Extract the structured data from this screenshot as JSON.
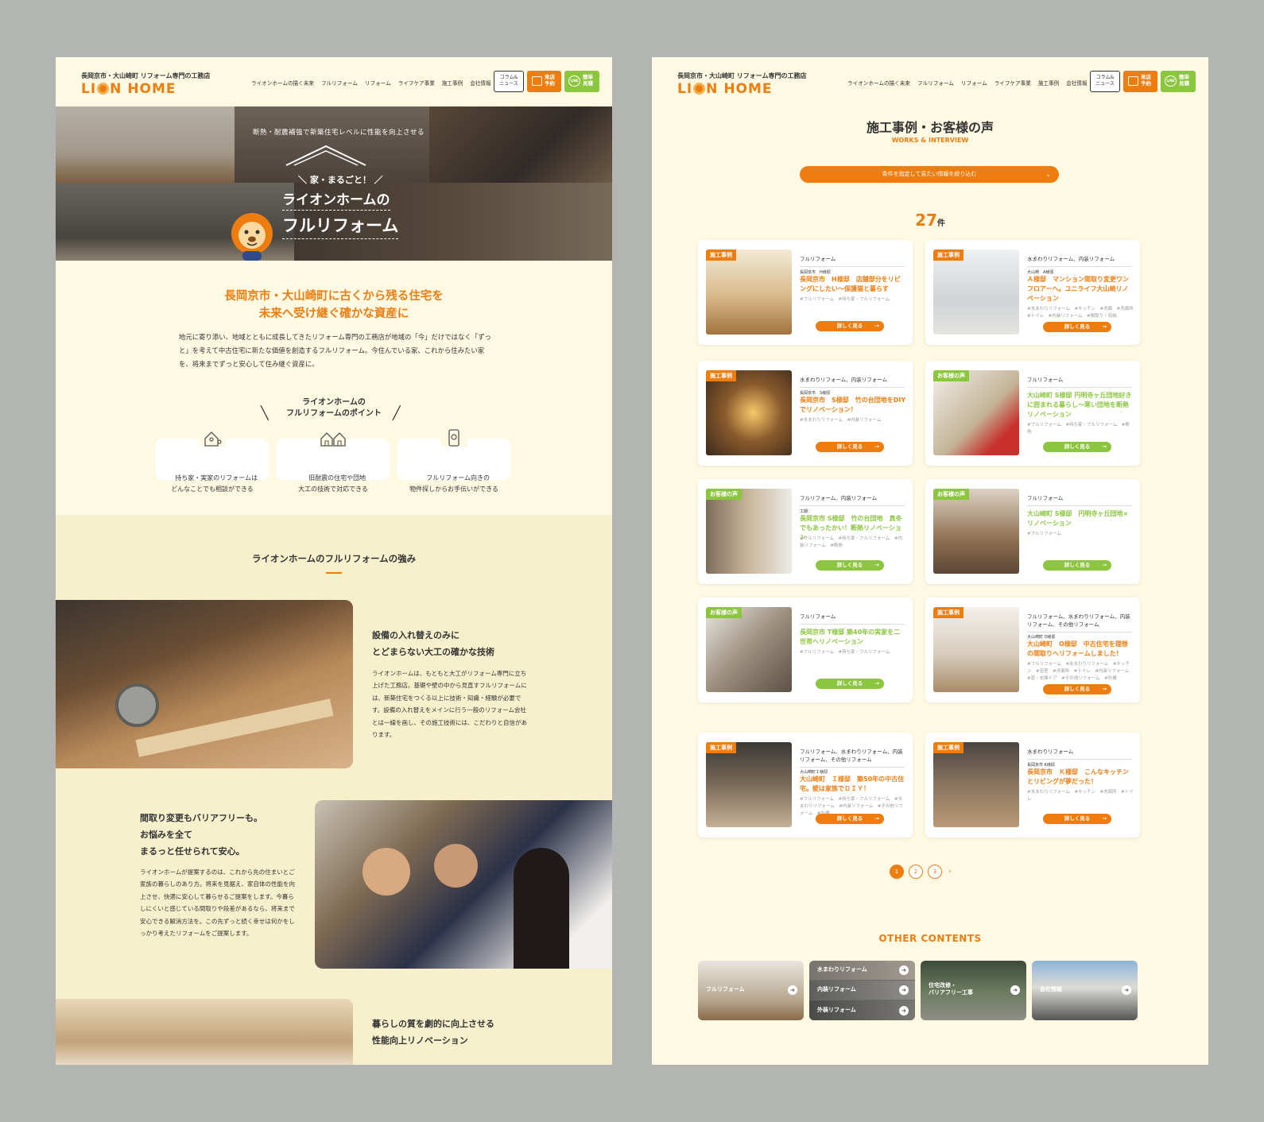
{
  "header": {
    "tagline": "長岡京市・大山崎町 リフォーム専門の工務店",
    "logo_a": "LI",
    "logo_b": "N HOME",
    "nav": [
      "ライオンホームの描く未来",
      "フルリフォーム",
      "リフォーム",
      "ライフケア事業",
      "施工事例",
      "会社情報"
    ],
    "column_btn": "コラム&\nニュース",
    "reserve_btn": "来店\n予約",
    "line_btn": "簡単\n見積",
    "line_icon_text": "LINE"
  },
  "hero": {
    "sub": "断熱・耐震補強で新築住宅レベルに性能を向上させる",
    "kicker": "＼ 家・まるごと！ ／",
    "title1": "ライオンホームの",
    "title2": "フルリフォーム"
  },
  "intro": {
    "heading1": "長岡京市・大山崎町に古くから残る住宅を",
    "heading2": "未来へ受け継ぐ確かな資産に",
    "body": "地元に寄り添い、地域とともに成長してきたリフォーム専門の工務店が地域の「今」だけではなく「ずっと」を考えて中古住宅に新たな価値を創造するフルリフォーム。今住んでいる家、これから住みたい家を、将来までずっと安心して住み継ぐ資産に。",
    "points_heading": "ライオンホームの\nフルリフォームのポイント",
    "points": [
      {
        "text": "持ち家・実家のリフォームは\nどんなことでも相談ができる",
        "icon": "house-person-icon"
      },
      {
        "text": "旧耐震の住宅や団地\n大工の技術で対応できる",
        "icon": "houses-icon"
      },
      {
        "text": "フルリフォーム向きの\n物件探しからお手伝いができる",
        "icon": "phone-search-icon"
      }
    ]
  },
  "strengths": {
    "heading": "ライオンホームのフルリフォームの強み",
    "items": [
      {
        "title": "設備の入れ替えのみに\nとどまらない大工の確かな技術",
        "body": "ライオンホームは、もともと大工がリフォーム専門に立ち上げた工務店。基礎や壁の中から見直すフルリフォームには、新築住宅をつくる以上に技術・知識・経験が必要です。設備の入れ替えをメインに行う一般のリフォーム会社とは一線を画し、その施工技術には、こだわりと自信があります。"
      },
      {
        "title": "間取り変更もバリアフリーも。\nお悩みを全て\nまるっと任せられて安心。",
        "body": "ライオンホームが提案するのは、これから先の住まいとご家族の暮らしのあり方。将来を見据え、家自体の性能を向上させ、快適に安心して暮らせるご提案をします。今暮らしにくいと感じている間取りや段差があるなら、将来まで安心できる解消方法を。この先ずっと続く幸せは何かをしっかり考えたリフォームをご提案します。"
      },
      {
        "title": "暮らしの質を劇的に向上させる\n性能向上リノベーション",
        "body": ""
      }
    ]
  },
  "works": {
    "title": "施工事例・お客様の声",
    "subtitle": "WORKS & INTERVIEW",
    "filter_label": "条件を指定して見たい情報を絞り込む",
    "count": "27",
    "count_unit": "件",
    "more_label": "詳しく見る",
    "cards": [
      {
        "badge": "施工事例",
        "color": "or",
        "category": "フルリフォーム",
        "location": "長岡京市　H様邸",
        "title": "長岡京市　H様邸　店舗部分をリビングにしたい～保護猫と暮らす",
        "tags": "#フルリフォーム　#持ち家・フルリフォーム"
      },
      {
        "badge": "施工事例",
        "color": "or",
        "category": "水まわりリフォーム、内装リフォーム",
        "location": "大山崎　A様邸",
        "title": "Ａ様邸　マンション間取り変更ワンフロアーへ。ユニライフ大山崎リノベーション",
        "tags": "#水まわりリフォーム　#キッチン　#洗面　#洗面所　#トイレ　#内装リフォーム　#間取り・収納"
      },
      {
        "badge": "施工事例",
        "color": "or",
        "category": "水まわりリフォーム、内装リフォーム",
        "location": "長岡京市　S様邸",
        "title": "長岡京市　S様邸　竹の台団地をDIYでリノベーション！",
        "tags": "#水まわりリフォーム　#内装リフォーム"
      },
      {
        "badge": "お客様の声",
        "color": "gr",
        "category": "フルリフォーム",
        "location": "",
        "title": "大山崎町 S様邸 円明寺ヶ丘団地好きに囲まれる暮らし～寒い団地を断熱リノベーション",
        "tags": "#フルリフォーム　#持ち家・フルリフォーム　#断熱"
      },
      {
        "badge": "お客様の声",
        "color": "gr",
        "category": "フルリフォーム、内装リフォーム",
        "location": "工期：",
        "title": "長岡京市 S様邸　竹の台団地　真冬でもあったかい！断熱リノベーション",
        "tags": "#フルリフォーム　#持ち家・フルリフォーム　#内装リフォーム　#断熱"
      },
      {
        "badge": "お客様の声",
        "color": "gr",
        "category": "フルリフォーム",
        "location": "",
        "title": "大山崎町 S様邸　円明寺ヶ丘団地×リノベーション",
        "tags": "#フルリフォーム"
      },
      {
        "badge": "お客様の声",
        "color": "gr",
        "category": "フルリフォーム",
        "location": "",
        "title": "長岡京市 T様邸 築40年の実家を二世帯へリノベーション",
        "tags": "#フルリフォーム　#持ち家・フルリフォーム"
      },
      {
        "badge": "施工事例",
        "color": "or",
        "category": "フルリフォーム、水まわりリフォーム、内装リフォーム、その他リフォーム",
        "location": "大山崎町 O様邸",
        "title": "大山崎町　O様邸　中古住宅を理想の間取りへリフォームしました！",
        "tags": "#フルリフォーム　#水まわりリフォーム　#キッチン　#浴室　#洗面所　#トイレ　#内装リフォーム　#窓・玄関ドア　#その他リフォーム　#外構"
      },
      {
        "badge": "施工事例",
        "color": "or",
        "category": "フルリフォーム、水まわりリフォーム、内装リフォーム、その他リフォーム",
        "location": "大山崎町Ｉ様邸",
        "title": "大山崎町　Ｉ様邸　築50年の中古住宅。壁は家族でＤＩＹ！",
        "tags": "#フルリフォーム　#持ち家・フルリフォーム　#水まわりリフォーム　#内装リフォーム　#その他リフォーム　#外構"
      },
      {
        "badge": "施工事例",
        "color": "or",
        "category": "水まわりリフォーム",
        "location": "長岡京市 K様邸",
        "title": "長岡京市　Ｋ様邸　こんなキッチンとリビングが夢だった！",
        "tags": "#水まわりリフォーム　#キッチン　#洗面所　#トイレ"
      }
    ],
    "pages": [
      "1",
      "2",
      "3"
    ],
    "next": "›"
  },
  "other": {
    "heading": "OTHER CONTENTS",
    "items": [
      "フルリフォーム",
      "水まわりリフォーム",
      "内装リフォーム",
      "外装リフォーム",
      "住宅改修・\nバリアフリー工事",
      "会社情報"
    ]
  },
  "colors": {
    "orange": "#ee7d10",
    "green": "#8cc63f",
    "cream": "#fdf9e3"
  }
}
